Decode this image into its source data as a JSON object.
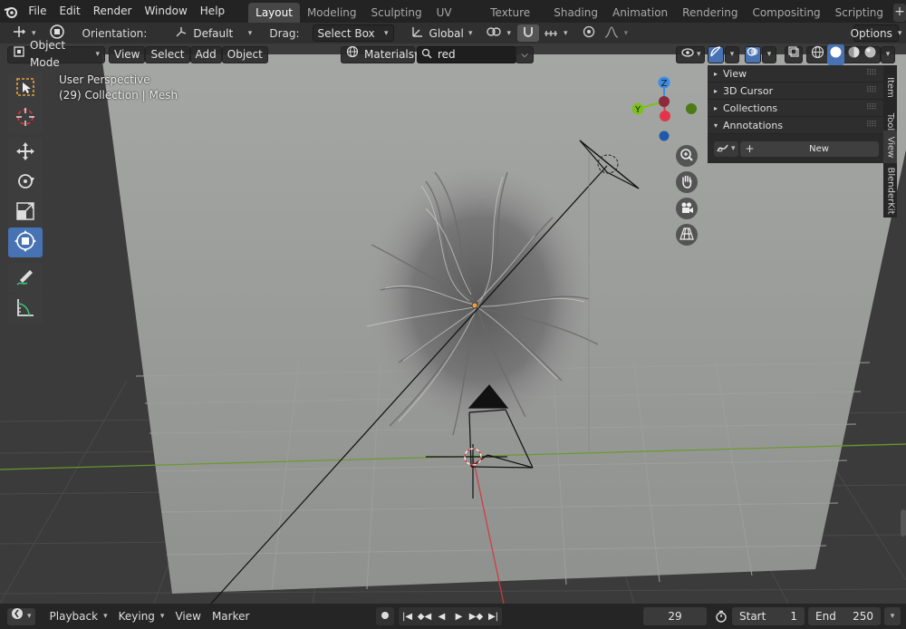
{
  "menu": [
    "File",
    "Edit",
    "Render",
    "Window",
    "Help"
  ],
  "workspaces": [
    "Layout",
    "Modeling",
    "Sculpting",
    "UV Editing",
    "Texture Paint",
    "Shading",
    "Animation",
    "Rendering",
    "Compositing",
    "Scripting"
  ],
  "workspace_add": "+",
  "toolheader": {
    "orientation_label": "Orientation:",
    "orientation_value": "Default",
    "drag_label": "Drag:",
    "drag_value": "Select Box",
    "transform_value": "Global",
    "options_label": "Options"
  },
  "viewport_header": {
    "mode": "Object Mode",
    "menus": [
      "View",
      "Select",
      "Add",
      "Object"
    ],
    "shading_label": "Materials",
    "search_value": "red"
  },
  "viewport_info": {
    "line1": "User Perspective",
    "line2": "(29) Collection | Mesh"
  },
  "gizmo": {
    "z": "Z",
    "y": "Y",
    "x_color": "#e3344c",
    "y_color": "#79c11c",
    "z_color": "#3a8ce5"
  },
  "npanel": {
    "sections": [
      {
        "label": "View",
        "open": false
      },
      {
        "label": "3D Cursor",
        "open": false
      },
      {
        "label": "Collections",
        "open": false
      },
      {
        "label": "Annotations",
        "open": true
      }
    ],
    "new_button": "New",
    "add_symbol": "+"
  },
  "side_tabs": [
    "Item",
    "Tool",
    "View",
    "BlenderKit"
  ],
  "timeline": {
    "menus": [
      "Playback",
      "Keying",
      "View",
      "Marker"
    ],
    "current_frame": "29",
    "start_label": "Start",
    "start_value": "1",
    "end_label": "End",
    "end_value": "250"
  },
  "colors": {
    "accent": "#4772b3",
    "active_tab": "#464646",
    "x_axis": "#d6363f",
    "y_axis": "#6a9a2a",
    "origin": "#e8a13a"
  }
}
